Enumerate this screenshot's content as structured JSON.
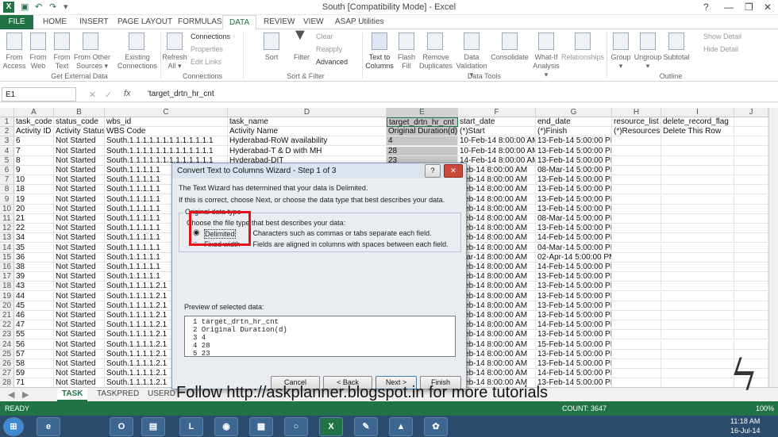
{
  "window": {
    "title": "South  [Compatibility Mode] - Excel"
  },
  "ribbon_tabs": [
    "FILE",
    "HOME",
    "INSERT",
    "PAGE LAYOUT",
    "FORMULAS",
    "DATA",
    "REVIEW",
    "VIEW",
    "ASAP Utilities"
  ],
  "ribbon": {
    "get_external": {
      "buttons": [
        "From Access",
        "From Web",
        "From Text",
        "From Other Sources ▾",
        "Existing Connections"
      ],
      "group": "Get External Data"
    },
    "connections": {
      "refresh": "Refresh All ▾",
      "items": [
        "Connections",
        "Properties",
        "Edit Links"
      ],
      "group": "Connections"
    },
    "sort_filter": {
      "sort": "Sort",
      "filter": "Filter",
      "items": [
        "Clear",
        "Reapply",
        "Advanced"
      ],
      "group": "Sort & Filter"
    },
    "data_tools": {
      "buttons": [
        "Text to Columns",
        "Flash Fill",
        "Remove Duplicates",
        "Data Validation ▾",
        "Consolidate",
        "What-If Analysis ▾",
        "Relationships"
      ],
      "group": "Data Tools"
    },
    "outline": {
      "buttons": [
        "Group ▾",
        "Ungroup ▾",
        "Subtotal"
      ],
      "items": [
        "Show Detail",
        "Hide Detail"
      ],
      "group": "Outline"
    }
  },
  "formula_bar": {
    "name_box": "E1",
    "fx": "fx",
    "content": "'target_drtn_hr_cnt"
  },
  "columns": [
    "A",
    "B",
    "C",
    "D",
    "E",
    "F",
    "G",
    "H",
    "I",
    "J"
  ],
  "header_row1": [
    "task_code",
    "status_code",
    "wbs_id",
    "task_name",
    "target_drtn_hr_cnt",
    "start_date",
    "end_date",
    "resource_list",
    "delete_record_flag",
    ""
  ],
  "header_row2": [
    "Activity ID",
    "Activity Status",
    "WBS Code",
    "Activity Name",
    "Original Duration(d)",
    "(*)Start",
    "(*)Finish",
    "(*)Resources",
    "Delete This Row",
    ""
  ],
  "rows": [
    {
      "rn": "3",
      "a": "6",
      "b": "Not Started",
      "c": "South.1.1.1.1.1.1.1.1.1.1.1.1.1",
      "d": "Hyderabad-RoW availability",
      "e": "4",
      "f": "10-Feb-14 8:00:00 AM",
      "g": "13-Feb-14 5:00:00 PM"
    },
    {
      "rn": "4",
      "a": "7",
      "b": "Not Started",
      "c": "South.1.1.1.1.1.1.1.1.1.1.1.1.1",
      "d": "Hyderabad-T & D with MH",
      "e": "28",
      "f": "10-Feb-14 8:00:00 AM",
      "g": "13-Feb-14 5:00:00 PM"
    },
    {
      "rn": "5",
      "a": "8",
      "b": "Not Started",
      "c": "South.1.1.1.1.1.1.1.1.1.1.1.1.1",
      "d": "Hyderabad-DIT",
      "e": "23",
      "f": "14-Feb-14 8:00:00 AM",
      "g": "13-Feb-14 5:00:00 PM"
    },
    {
      "rn": "6",
      "a": "9",
      "b": "Not Started",
      "c": "South.1.1.1.1.1",
      "d": "",
      "e": "",
      "f": "Feb-14 8:00:00 AM",
      "g": "08-Mar-14 5:00:00 PM"
    },
    {
      "rn": "7",
      "a": "10",
      "b": "Not Started",
      "c": "South.1.1.1.1.1",
      "d": "",
      "e": "",
      "f": "Feb-14 8:00:00 AM",
      "g": "13-Feb-14 5:00:00 PM"
    },
    {
      "rn": "8",
      "a": "18",
      "b": "Not Started",
      "c": "South.1.1.1.1.1",
      "d": "",
      "e": "",
      "f": "Feb-14 8:00:00 AM",
      "g": "13-Feb-14 5:00:00 PM"
    },
    {
      "rn": "9",
      "a": "19",
      "b": "Not Started",
      "c": "South.1.1.1.1.1",
      "d": "",
      "e": "",
      "f": "Feb-14 8:00:00 AM",
      "g": "13-Feb-14 5:00:00 PM"
    },
    {
      "rn": "10",
      "a": "20",
      "b": "Not Started",
      "c": "South.1.1.1.1.1",
      "d": "",
      "e": "",
      "f": "Feb-14 8:00:00 AM",
      "g": "13-Feb-14 5:00:00 PM"
    },
    {
      "rn": "11",
      "a": "21",
      "b": "Not Started",
      "c": "South.1.1.1.1.1",
      "d": "",
      "e": "",
      "f": "Feb-14 8:00:00 AM",
      "g": "08-Mar-14 5:00:00 PM"
    },
    {
      "rn": "12",
      "a": "22",
      "b": "Not Started",
      "c": "South.1.1.1.1.1",
      "d": "",
      "e": "",
      "f": "Feb-14 8:00:00 AM",
      "g": "13-Feb-14 5:00:00 PM"
    },
    {
      "rn": "13",
      "a": "34",
      "b": "Not Started",
      "c": "South.1.1.1.1.1",
      "d": "",
      "e": "",
      "f": "Feb-14 8:00:00 AM",
      "g": "14-Feb-14 5:00:00 PM"
    },
    {
      "rn": "14",
      "a": "35",
      "b": "Not Started",
      "c": "South.1.1.1.1.1",
      "d": "",
      "e": "",
      "f": "Feb-14 8:00:00 AM",
      "g": "04-Mar-14 5:00:00 PM"
    },
    {
      "rn": "15",
      "a": "36",
      "b": "Not Started",
      "c": "South.1.1.1.1.1",
      "d": "",
      "e": "",
      "f": "Mar-14 8:00:00 AM",
      "g": "02-Apr-14 5:00:00 PM"
    },
    {
      "rn": "16",
      "a": "38",
      "b": "Not Started",
      "c": "South.1.1.1.1.1",
      "d": "",
      "e": "",
      "f": "Feb-14 8:00:00 AM",
      "g": "14-Feb-14 5:00:00 PM"
    },
    {
      "rn": "17",
      "a": "39",
      "b": "Not Started",
      "c": "South.1.1.1.1.1",
      "d": "",
      "e": "",
      "f": "Feb-14 8:00:00 AM",
      "g": "13-Feb-14 5:00:00 PM"
    },
    {
      "rn": "18",
      "a": "43",
      "b": "Not Started",
      "c": "South.1.1.1.1.2.1",
      "d": "",
      "e": "",
      "f": "Feb-14 8:00:00 AM",
      "g": "13-Feb-14 5:00:00 PM"
    },
    {
      "rn": "19",
      "a": "44",
      "b": "Not Started",
      "c": "South.1.1.1.1.2.1",
      "d": "",
      "e": "",
      "f": "Feb-14 8:00:00 AM",
      "g": "13-Feb-14 5:00:00 PM"
    },
    {
      "rn": "20",
      "a": "45",
      "b": "Not Started",
      "c": "South.1.1.1.1.2.1",
      "d": "",
      "e": "",
      "f": "Feb-14 8:00:00 AM",
      "g": "13-Feb-14 5:00:00 PM"
    },
    {
      "rn": "21",
      "a": "46",
      "b": "Not Started",
      "c": "South.1.1.1.1.2.1",
      "d": "",
      "e": "",
      "f": "Feb-14 8:00:00 AM",
      "g": "13-Feb-14 5:00:00 PM"
    },
    {
      "rn": "22",
      "a": "47",
      "b": "Not Started",
      "c": "South.1.1.1.1.2.1",
      "d": "",
      "e": "",
      "f": "Feb-14 8:00:00 AM",
      "g": "14-Feb-14 5:00:00 PM"
    },
    {
      "rn": "23",
      "a": "55",
      "b": "Not Started",
      "c": "South.1.1.1.1.2.1",
      "d": "",
      "e": "",
      "f": "Feb-14 8:00:00 AM",
      "g": "13-Feb-14 5:00:00 PM"
    },
    {
      "rn": "24",
      "a": "56",
      "b": "Not Started",
      "c": "South.1.1.1.1.2.1",
      "d": "",
      "e": "",
      "f": "Feb-14 8:00:00 AM",
      "g": "15-Feb-14 5:00:00 PM"
    },
    {
      "rn": "25",
      "a": "57",
      "b": "Not Started",
      "c": "South.1.1.1.1.2.1",
      "d": "",
      "e": "",
      "f": "Feb-14 8:00:00 AM",
      "g": "13-Feb-14 5:00:00 PM"
    },
    {
      "rn": "26",
      "a": "58",
      "b": "Not Started",
      "c": "South.1.1.1.1.2.1",
      "d": "",
      "e": "",
      "f": "Feb-14 8:00:00 AM",
      "g": "13-Feb-14 5:00:00 PM"
    },
    {
      "rn": "27",
      "a": "59",
      "b": "Not Started",
      "c": "South.1.1.1.1.2.1",
      "d": "",
      "e": "",
      "f": "Feb-14 8:00:00 AM",
      "g": "14-Feb-14 5:00:00 PM"
    },
    {
      "rn": "28",
      "a": "71",
      "b": "Not Started",
      "c": "South.1.1.1.1.2.1",
      "d": "",
      "e": "",
      "f": "Feb-14 8:00:00 AM",
      "g": "13-Feb-14 5:00:00 PM"
    }
  ],
  "sheet_tabs": [
    "TASK",
    "TASKPRED",
    "USERD"
  ],
  "status": {
    "ready": "READY",
    "count": "COUNT: 3647",
    "zoom": "100%"
  },
  "dialog": {
    "title": "Convert Text to Columns Wizard - Step 1 of 3",
    "help": "?",
    "close": "✕",
    "line1": "The Text Wizard has determined that your data is Delimited.",
    "line2": "If this is correct, choose Next, or choose the data type that best describes your data.",
    "group_label": "Original data type",
    "choose": "Choose the file type that best describes your data:",
    "opt1": "Delimited",
    "opt1_desc": "- Characters such as commas or tabs separate each field.",
    "opt2": "Fixed width",
    "opt2_desc": "- Fields are aligned in columns with spaces between each field.",
    "preview_label": "Preview of selected data:",
    "preview_lines": [
      "1 target_drtn_hr_cnt",
      "2 Original Duration(d)",
      "3 4",
      "4 28",
      "5 23"
    ],
    "buttons": [
      "Cancel",
      "< Back",
      "Next >",
      "Finish"
    ]
  },
  "overlay": {
    "follow": "Follow http://askplanner.blogspot.in for more tutorials"
  },
  "clock": {
    "time": "11:18 AM",
    "date": "16-Jul-14"
  },
  "colors": {
    "excel_green": "#217346",
    "highlight_red": "#e2131a",
    "taskbar": "#2b4c6d"
  }
}
